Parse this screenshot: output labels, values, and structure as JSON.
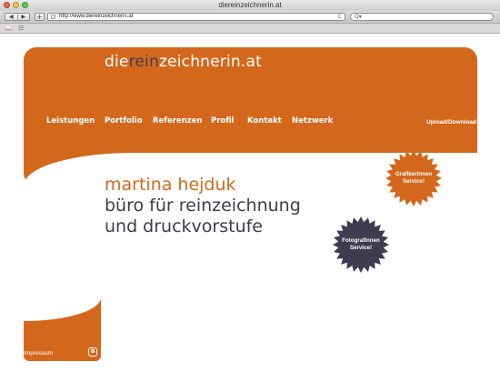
{
  "window": {
    "title": "diereinzeichnerin.at"
  },
  "toolbar": {
    "back": "◀",
    "forward": "▶",
    "add": "+",
    "url": "http://www.diereinzeichnerin.at",
    "reload": "C",
    "search_icon": "Q▾"
  },
  "bookmarks": {
    "book_icon": "book-icon",
    "grid_icon": "grid-icon"
  },
  "logo": {
    "part1": "die",
    "part2": "rein",
    "part3": "zeichnerin.at"
  },
  "nav": {
    "items": [
      "Leistungen",
      "Portfolio",
      "Referenzen",
      "Profil",
      "Kontakt",
      "Netzwerk"
    ],
    "upload": "Upload/Download"
  },
  "headline": {
    "line1": "martina hejduk",
    "line2": "büro für reinzeichnung",
    "line3": "und druckvorstufe"
  },
  "badges": {
    "grafiker": {
      "line1": "GrafikerInnen",
      "line2": "Service!"
    },
    "fotograf": {
      "line1": "FotografInnen",
      "line2": "Service!"
    }
  },
  "footer": {
    "impressum": "Impressum",
    "logo_letter": "a"
  },
  "colors": {
    "brand_orange": "#d3681d",
    "dark_slate": "#3e3d4f",
    "white": "#ffffff"
  }
}
